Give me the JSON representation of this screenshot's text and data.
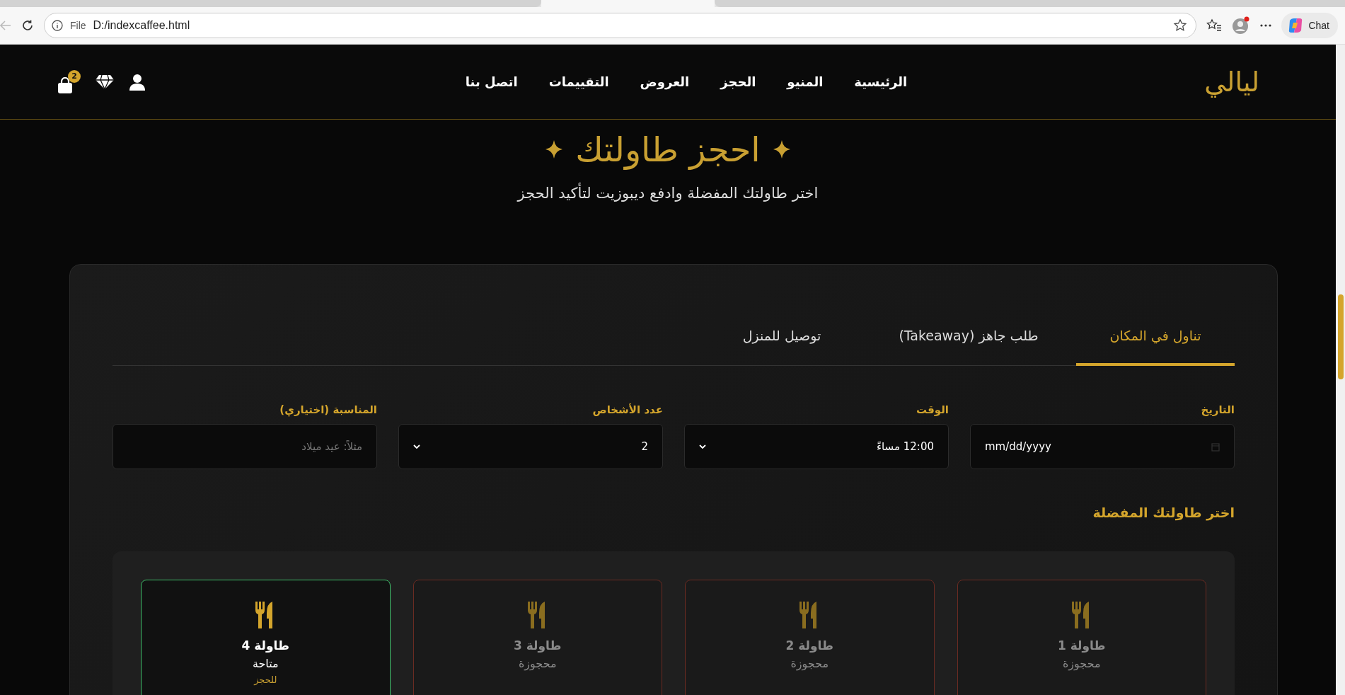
{
  "browser": {
    "file_label": "File",
    "address": "D:/indexcaffee.html",
    "chat_label": "Chat"
  },
  "nav": {
    "logo": "ليالي",
    "links": [
      "الرئيسية",
      "المنيو",
      "الحجز",
      "العروض",
      "التقييمات",
      "اتصل بنا"
    ],
    "cart_count": "2"
  },
  "hero": {
    "title": "احجز طاولتك",
    "subtitle": "اختر طاولتك المفضلة وادفع ديبوزيت لتأكيد الحجز"
  },
  "booking": {
    "tabs": [
      {
        "label": "تناول في المكان",
        "selected": true
      },
      {
        "label": "طلب جاهز (Takeaway)",
        "selected": false
      },
      {
        "label": "توصيل للمنزل",
        "selected": false
      }
    ],
    "fields": [
      {
        "kind": "date",
        "label": "التاريخ",
        "value": "mm/dd/yyyy"
      },
      {
        "kind": "select",
        "label": "الوقت",
        "value": "12:00 مساءً"
      },
      {
        "kind": "select",
        "label": "عدد الأشخاص",
        "value": "2"
      },
      {
        "kind": "text",
        "label": "المناسبة (اختياري)",
        "placeholder": "مثلاً: عيد ميلاد"
      }
    ],
    "tables_heading": "اختر طاولتك المفضلة",
    "tables": [
      {
        "name": "طاولة 1",
        "status": "محجوزة",
        "available": false
      },
      {
        "name": "طاولة 2",
        "status": "محجوزة",
        "available": false
      },
      {
        "name": "طاولة 3",
        "status": "محجوزة",
        "available": false
      },
      {
        "name": "طاولة 4",
        "status": "متاحة",
        "available": true,
        "note": "للحجز"
      }
    ]
  }
}
